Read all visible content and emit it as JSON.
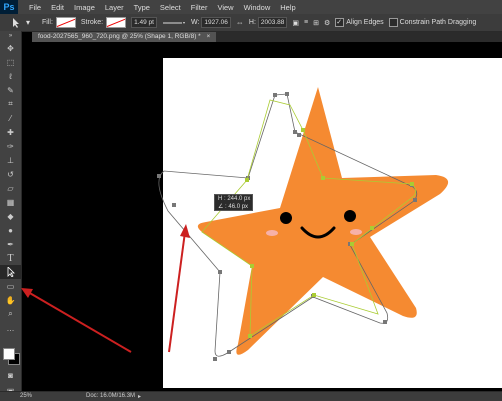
{
  "app": {
    "logo": "Ps"
  },
  "menu": [
    "File",
    "Edit",
    "Image",
    "Layer",
    "Type",
    "Select",
    "Filter",
    "View",
    "Window",
    "Help"
  ],
  "options": {
    "fill_label": "Fill:",
    "stroke_label": "Stroke:",
    "stroke_width": "1.49 pt",
    "w_label": "W:",
    "w_value": "1927.06",
    "h_label": "H:",
    "h_value": "2003.88",
    "align_edges_label": "Align Edges",
    "align_edges_checked": true,
    "constrain_label": "Constrain Path Dragging",
    "constrain_checked": false
  },
  "document_tab": {
    "label": "food-2027565_960_720.png @ 25% (Shape 1, RGB/8) *"
  },
  "tooltip": {
    "line1": "H :   244.0 px",
    "line2": "∠ :    46.0 px"
  },
  "status": {
    "zoom": "25%",
    "doc": "Doc: 16.0M/16.3M"
  },
  "colors": {
    "star": "#f58a31",
    "path_green": "#aacc33",
    "path_gray": "#666666",
    "arrow": "#cc2020",
    "cheek": "#f7b1a8"
  },
  "toolbox": [
    "move-icon",
    "marquee-icon",
    "lasso-icon",
    "quick-select-icon",
    "crop-icon",
    "eyedropper-icon",
    "healing-icon",
    "brush-icon",
    "clone-stamp-icon",
    "history-brush-icon",
    "eraser-icon",
    "gradient-icon",
    "blur-icon",
    "dodge-icon",
    "pen-icon",
    "type-icon",
    "path-selection-icon",
    "shape-icon",
    "hand-icon",
    "zoom-icon"
  ]
}
